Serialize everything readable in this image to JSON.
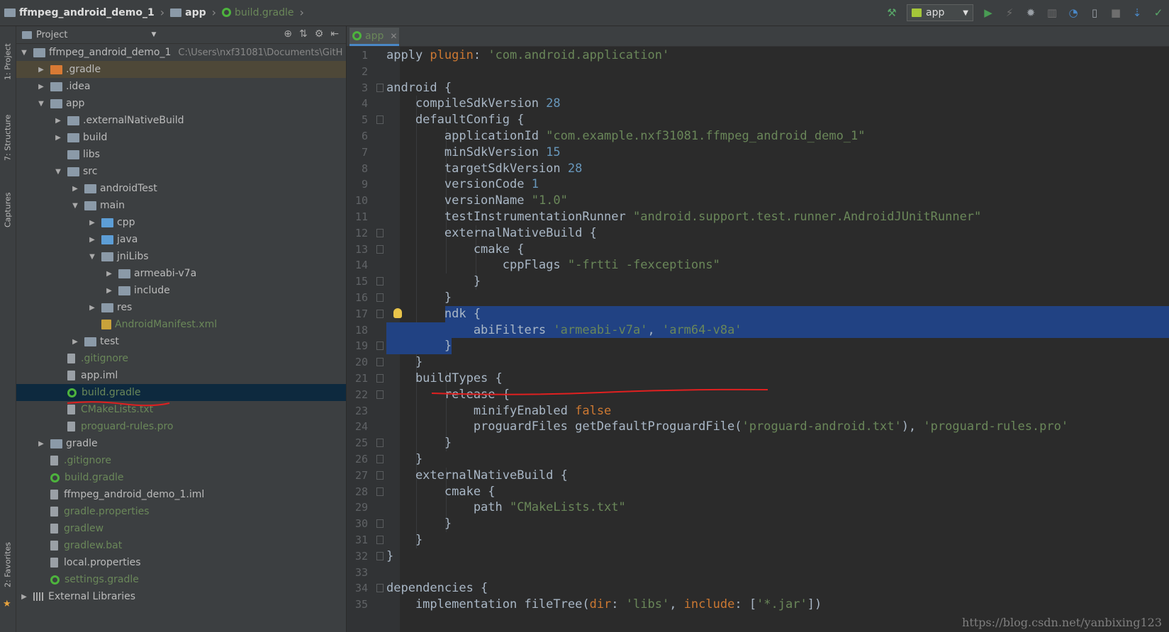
{
  "breadcrumb": [
    "ffmpeg_android_demo_1",
    "app",
    "build.gradle"
  ],
  "toolbar": {
    "run_config": "app"
  },
  "left_strip": {
    "tab_project": "1: Project",
    "tab_structure": "7: Structure",
    "tab_captures": "Captures",
    "tab_favorites": "2: Favorites"
  },
  "project_panel": {
    "title": "Project",
    "tree": [
      {
        "label": "ffmpeg_android_demo_1",
        "path": "C:\\Users\\nxf31081\\Documents\\GitH",
        "depth": 0,
        "arrow": "▼",
        "icon": "folder"
      },
      {
        "label": ".gradle",
        "depth": 1,
        "arrow": "▶",
        "icon": "folderorange"
      },
      {
        "label": ".idea",
        "depth": 1,
        "arrow": "▶",
        "icon": "folder"
      },
      {
        "label": "app",
        "depth": 1,
        "arrow": "▼",
        "icon": "folder"
      },
      {
        "label": ".externalNativeBuild",
        "depth": 2,
        "arrow": "▶",
        "icon": "folder"
      },
      {
        "label": "build",
        "depth": 2,
        "arrow": "▶",
        "icon": "folder"
      },
      {
        "label": "libs",
        "depth": 2,
        "arrow": "",
        "icon": "folder"
      },
      {
        "label": "src",
        "depth": 2,
        "arrow": "▼",
        "icon": "folder"
      },
      {
        "label": "androidTest",
        "depth": 3,
        "arrow": "▶",
        "icon": "folder"
      },
      {
        "label": "main",
        "depth": 3,
        "arrow": "▼",
        "icon": "folder"
      },
      {
        "label": "cpp",
        "depth": 4,
        "arrow": "▶",
        "icon": "folderblue"
      },
      {
        "label": "java",
        "depth": 4,
        "arrow": "▶",
        "icon": "folderblue"
      },
      {
        "label": "jniLibs",
        "depth": 4,
        "arrow": "▼",
        "icon": "folder"
      },
      {
        "label": "armeabi-v7a",
        "depth": 5,
        "arrow": "▶",
        "icon": "folder"
      },
      {
        "label": "include",
        "depth": 5,
        "arrow": "▶",
        "icon": "folder"
      },
      {
        "label": "res",
        "depth": 4,
        "arrow": "▶",
        "icon": "folder"
      },
      {
        "label": "AndroidManifest.xml",
        "depth": 4,
        "arrow": "",
        "icon": "xml",
        "color": "green"
      },
      {
        "label": "test",
        "depth": 3,
        "arrow": "▶",
        "icon": "folder"
      },
      {
        "label": ".gitignore",
        "depth": 2,
        "arrow": "",
        "icon": "file",
        "color": "green"
      },
      {
        "label": "app.iml",
        "depth": 2,
        "arrow": "",
        "icon": "file"
      },
      {
        "label": "build.gradle",
        "depth": 2,
        "arrow": "",
        "icon": "gradle",
        "color": "green",
        "selected": true
      },
      {
        "label": "CMakeLists.txt",
        "depth": 2,
        "arrow": "",
        "icon": "file",
        "color": "green"
      },
      {
        "label": "proguard-rules.pro",
        "depth": 2,
        "arrow": "",
        "icon": "file",
        "color": "green"
      },
      {
        "label": "gradle",
        "depth": 1,
        "arrow": "▶",
        "icon": "folder"
      },
      {
        "label": ".gitignore",
        "depth": 1,
        "arrow": "",
        "icon": "file",
        "color": "green"
      },
      {
        "label": "build.gradle",
        "depth": 1,
        "arrow": "",
        "icon": "gradle",
        "color": "green"
      },
      {
        "label": "ffmpeg_android_demo_1.iml",
        "depth": 1,
        "arrow": "",
        "icon": "file"
      },
      {
        "label": "gradle.properties",
        "depth": 1,
        "arrow": "",
        "icon": "file",
        "color": "green"
      },
      {
        "label": "gradlew",
        "depth": 1,
        "arrow": "",
        "icon": "file",
        "color": "green"
      },
      {
        "label": "gradlew.bat",
        "depth": 1,
        "arrow": "",
        "icon": "file",
        "color": "green"
      },
      {
        "label": "local.properties",
        "depth": 1,
        "arrow": "",
        "icon": "file"
      },
      {
        "label": "settings.gradle",
        "depth": 1,
        "arrow": "",
        "icon": "gradle",
        "color": "green"
      },
      {
        "label": "External Libraries",
        "depth": 0,
        "arrow": "▶",
        "icon": "lib"
      }
    ]
  },
  "editor": {
    "tab_label": "app",
    "lines": [
      [
        [
          "apply ",
          "p"
        ],
        [
          "plugin",
          "kw"
        ],
        [
          ": ",
          "p"
        ],
        [
          "'com.android.application'",
          "s"
        ]
      ],
      [],
      [
        [
          "android {",
          "p"
        ]
      ],
      [
        [
          "    compileSdkVersion ",
          "p"
        ],
        [
          "28",
          "n"
        ]
      ],
      [
        [
          "    defaultConfig {",
          "p"
        ]
      ],
      [
        [
          "        applicationId ",
          "p"
        ],
        [
          "\"com.example.nxf31081.ffmpeg_android_demo_1\"",
          "s"
        ]
      ],
      [
        [
          "        minSdkVersion ",
          "p"
        ],
        [
          "15",
          "n"
        ]
      ],
      [
        [
          "        targetSdkVersion ",
          "p"
        ],
        [
          "28",
          "n"
        ]
      ],
      [
        [
          "        versionCode ",
          "p"
        ],
        [
          "1",
          "n"
        ]
      ],
      [
        [
          "        versionName ",
          "p"
        ],
        [
          "\"1.0\"",
          "s"
        ]
      ],
      [
        [
          "        testInstrumentationRunner ",
          "p"
        ],
        [
          "\"android.support.test.runner.AndroidJUnitRunner\"",
          "s"
        ]
      ],
      [
        [
          "        externalNativeBuild {",
          "p"
        ]
      ],
      [
        [
          "            cmake {",
          "p"
        ]
      ],
      [
        [
          "                cppFlags ",
          "p"
        ],
        [
          "\"-frtti -fexceptions\"",
          "s"
        ]
      ],
      [
        [
          "            }",
          "p"
        ]
      ],
      [
        [
          "        }",
          "p"
        ]
      ],
      [
        [
          "        ndk {",
          "p"
        ]
      ],
      [
        [
          "            abiFilters ",
          "p"
        ],
        [
          "'armeabi-v7a'",
          "s"
        ],
        [
          ", ",
          "p"
        ],
        [
          "'arm64-v8a'",
          "s"
        ]
      ],
      [
        [
          "        }",
          "p"
        ]
      ],
      [
        [
          "    }",
          "p"
        ]
      ],
      [
        [
          "    buildTypes {",
          "p"
        ]
      ],
      [
        [
          "        release {",
          "p"
        ]
      ],
      [
        [
          "            minifyEnabled ",
          "p"
        ],
        [
          "false",
          "kw"
        ]
      ],
      [
        [
          "            proguardFiles getDefaultProguardFile(",
          "p"
        ],
        [
          "'proguard-android.txt'",
          "s"
        ],
        [
          "), ",
          "p"
        ],
        [
          "'proguard-rules.pro'",
          "s"
        ]
      ],
      [
        [
          "        }",
          "p"
        ]
      ],
      [
        [
          "    }",
          "p"
        ]
      ],
      [
        [
          "    externalNativeBuild {",
          "p"
        ]
      ],
      [
        [
          "        cmake {",
          "p"
        ]
      ],
      [
        [
          "            path ",
          "p"
        ],
        [
          "\"CMakeLists.txt\"",
          "s"
        ]
      ],
      [
        [
          "        }",
          "p"
        ]
      ],
      [
        [
          "    }",
          "p"
        ]
      ],
      [
        [
          "}",
          "p"
        ]
      ],
      [],
      [
        [
          "dependencies {",
          "p"
        ]
      ],
      [
        [
          "    implementation fileTree(",
          "p"
        ],
        [
          "dir",
          "kw"
        ],
        [
          ": ",
          "p"
        ],
        [
          "'libs'",
          "s"
        ],
        [
          ", ",
          "p"
        ],
        [
          "include",
          "kw"
        ],
        [
          ": [",
          "p"
        ],
        [
          "'*.jar'",
          "s"
        ],
        [
          "])",
          "p"
        ]
      ]
    ]
  },
  "watermark": "https://blog.csdn.net/yanbixing123"
}
